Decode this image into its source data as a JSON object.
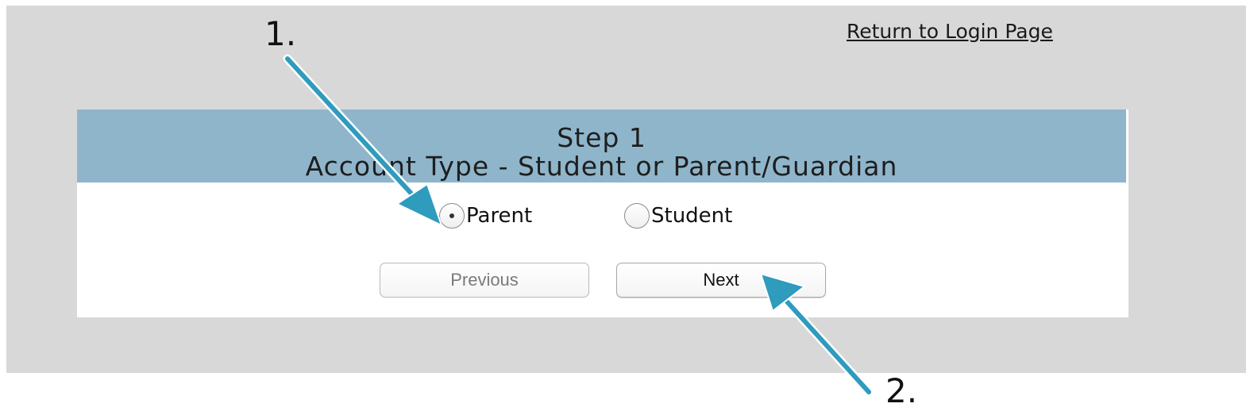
{
  "header_link": {
    "return_label": "Return to Login Page"
  },
  "step": {
    "title": "Step 1",
    "subtitle": "Account Type - Student or Parent/Guardian"
  },
  "account_type": {
    "options": [
      {
        "label": "Parent",
        "selected": true
      },
      {
        "label": "Student",
        "selected": false
      }
    ]
  },
  "buttons": {
    "previous_label": "Previous",
    "next_label": "Next"
  },
  "annotations": {
    "callout_1": "1.",
    "callout_2": "2.",
    "arrow_color": "#2f9bbd"
  },
  "colors": {
    "panel_bg": "#d8d8d8",
    "header_bg": "#8fb5cb"
  }
}
